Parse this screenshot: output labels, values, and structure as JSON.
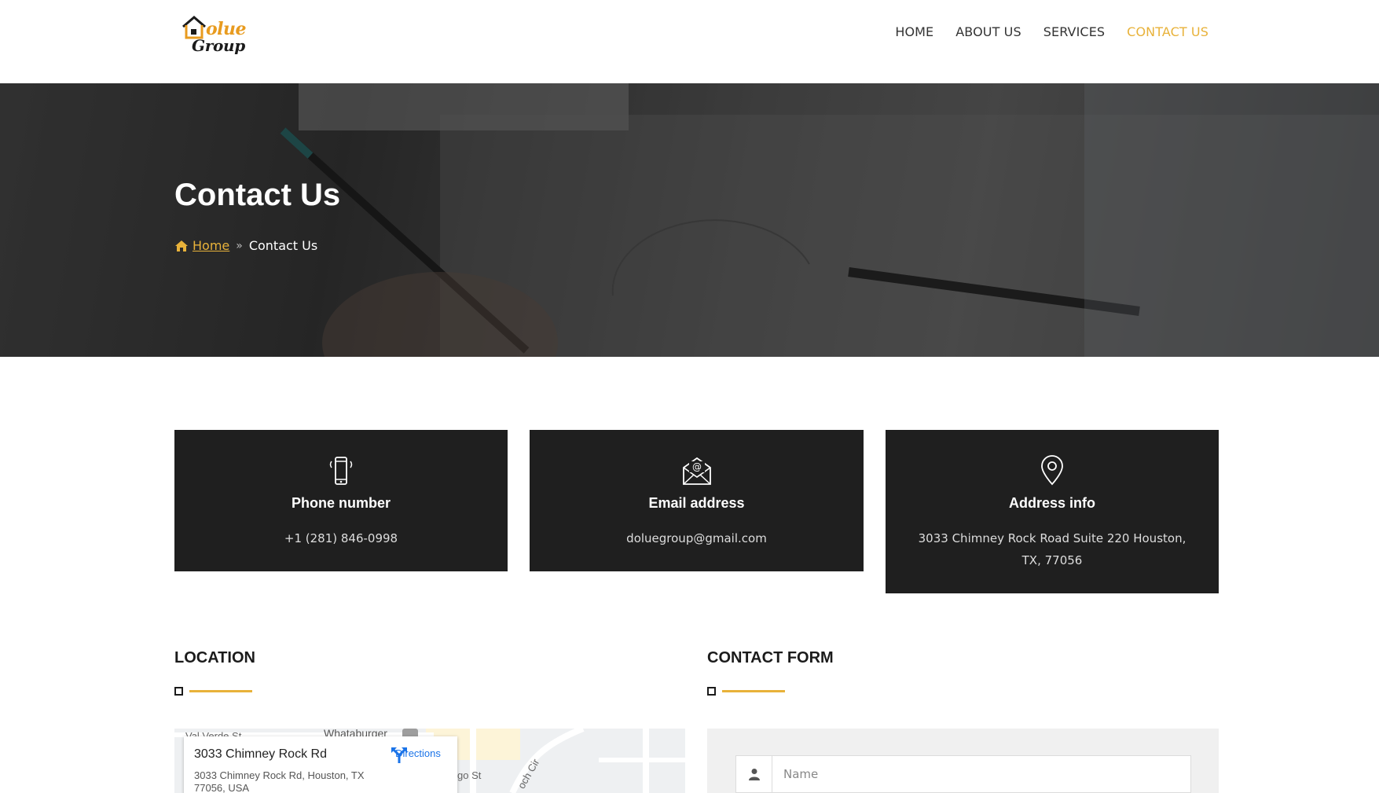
{
  "brand": {
    "logo_line1": "olue",
    "logo_line2": "Group",
    "accent": "#e8b23a",
    "dark": "#1f1f1f"
  },
  "nav": {
    "items": [
      {
        "label": "HOME",
        "active": false
      },
      {
        "label": "ABOUT US",
        "active": false
      },
      {
        "label": "SERVICES",
        "active": false
      },
      {
        "label": "CONTACT US",
        "active": true
      }
    ]
  },
  "hero": {
    "title": "Contact Us",
    "breadcrumb": {
      "home": "Home",
      "current": "Contact Us"
    }
  },
  "cards": [
    {
      "icon": "smartphone-icon",
      "title": "Phone number",
      "text": "+1 (281) 846-0998"
    },
    {
      "icon": "envelope-at-icon",
      "title": "Email address",
      "text": "doluegroup@gmail.com"
    },
    {
      "icon": "location-pin-icon",
      "title": "Address info",
      "text": "3033 Chimney Rock Road Suite 220 Houston, TX, 77056"
    }
  ],
  "sections": {
    "location": "LOCATION",
    "contact_form": "CONTACT FORM"
  },
  "map": {
    "streets": [
      "Val Verde St",
      "Whataburger",
      "go St",
      "och Cir"
    ],
    "place_title": "3033 Chimney Rock Rd",
    "place_address": "3033 Chimney Rock Rd, Houston, TX 77056, USA",
    "directions_label": "Directions"
  },
  "form": {
    "name_placeholder": "Name"
  }
}
